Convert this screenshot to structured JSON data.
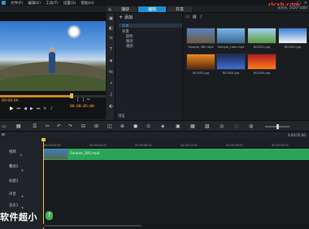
{
  "menu": [
    "文件(F)",
    "编辑(E)",
    "工具(T)",
    "设置(S)",
    "帮助(H)"
  ],
  "workspace_tabs": {
    "capture": "捕获",
    "edit": "编辑",
    "share": "共享"
  },
  "project_info": {
    "line1": "未命名, 1920*1080",
    "line2": ""
  },
  "site_watermark": "rjcxb.com",
  "player": {
    "timecode_left": "00:00:00",
    "timecode": "00:00:05:00"
  },
  "library": {
    "add_label": "添加",
    "tree": [
      "样本",
      "背景",
      "颜色",
      "图形",
      "视频"
    ],
    "selected_index": 0,
    "browse_label": "浏览",
    "thumbs": [
      {
        "caption": "Sample_360.mp4",
        "color1": "#5a83c0",
        "color2": "#6b5a3d"
      },
      {
        "caption": "Sample_Lake.mp4",
        "color1": "#7db5e6",
        "color2": "#3a6b8f"
      },
      {
        "caption": "BG-B01.jpg",
        "color1": "#9fd2f5",
        "color2": "#5e9b3b"
      },
      {
        "caption": "BG-B02.jpg",
        "color1": "#3e7fd5",
        "color2": "#f2f4f7"
      },
      {
        "caption": "BG-B03.jpg",
        "color1": "#f08a1c",
        "color2": "#5a2a0f"
      },
      {
        "caption": "BG-B04.jpg",
        "color1": "#1d2c5c",
        "color2": "#3f6fd2"
      },
      {
        "caption": "BG-B05.jpg",
        "color1": "#b21d1d",
        "color2": "#ff7a1c"
      }
    ]
  },
  "timeline": {
    "ruler": [
      "00:00:00:00",
      "00:00:04:00",
      "00:00:08:00",
      "00:00:12:00",
      "00:00:16:00",
      "00:00:20:00"
    ],
    "clip_label": "Sample_360.mp4",
    "tracks": [
      "视频",
      "叠加1",
      "标题1",
      "声音",
      "音乐1"
    ],
    "zoom": "0:00:05:00"
  },
  "watermark": {
    "text": "软件超小",
    "badge": "?"
  }
}
